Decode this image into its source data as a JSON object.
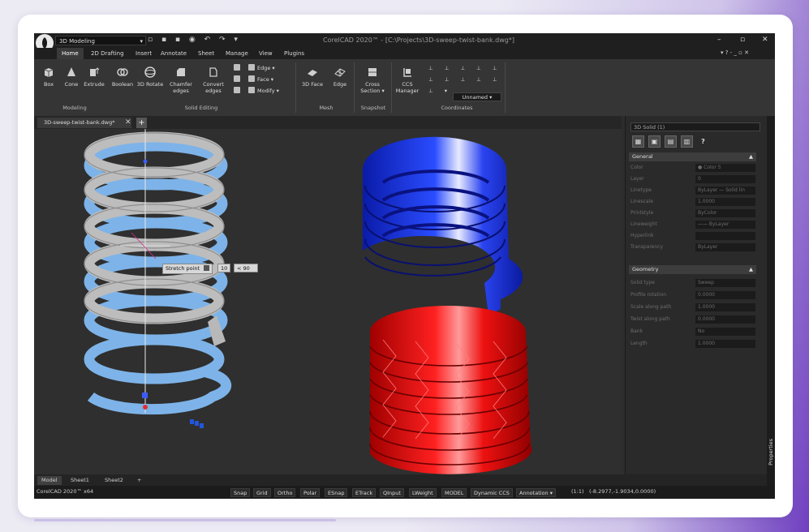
{
  "app": {
    "workspace": "3D Modeling",
    "window_title": "CorelCAD 2020™ - [C:\\Projects\\3D-sweep-twist-bank.dwg*]",
    "brand_color": "#ffffff"
  },
  "menu": {
    "items": [
      "Home",
      "2D Drafting",
      "Insert",
      "Annotate",
      "Sheet",
      "Manage",
      "View",
      "Plugins"
    ],
    "right": "▾  ?  -  _  ▫  ✕"
  },
  "ribbon": {
    "buttons": {
      "box": "Box",
      "cone": "Cone",
      "extrude": "Extrude",
      "boolean": "Boolean",
      "rotate3d": "3D Rotate",
      "chamfer": "Chamfer edges",
      "convert": "Convert edges",
      "edge": "Edge",
      "face": "Face",
      "modify": "Modify",
      "face3d": "3D Face",
      "edge_mesh": "Edge",
      "cross": "Cross Section",
      "ccs": "CCS Manager"
    },
    "groups": {
      "modeling": "Modeling",
      "solid_editing": "Solid Editing",
      "mesh": "Mesh",
      "snapshot": "Snapshot",
      "coordinates": "Coordinates"
    },
    "ccs_value": "Unnamed"
  },
  "document": {
    "tab": "3D-sweep-twist-bank.dwg*"
  },
  "viewport": {
    "stretch_label": "Stretch point",
    "input_value": "10",
    "angle_value": "< 90"
  },
  "properties": {
    "selection": "3D Solid (1)",
    "general_header": "General",
    "geometry_header": "Geometry",
    "general_rows": [
      {
        "label": "Color",
        "value": "● Color 5"
      },
      {
        "label": "Layer",
        "value": "0"
      },
      {
        "label": "Linetype",
        "value": "ByLayer — Solid lin"
      },
      {
        "label": "Linescale",
        "value": "1.0000"
      },
      {
        "label": "Printstyle",
        "value": "ByColor"
      },
      {
        "label": "Lineweight",
        "value": "—— ByLayer"
      },
      {
        "label": "Hyperlink",
        "value": ""
      },
      {
        "label": "Transparency",
        "value": "ByLayer"
      }
    ],
    "geometry_rows": [
      {
        "label": "Solid type",
        "value": "Sweep"
      },
      {
        "label": "Profile rotation",
        "value": "0.0000"
      },
      {
        "label": "Scale along path",
        "value": "1.0000"
      },
      {
        "label": "Twist along path",
        "value": "0.0000"
      },
      {
        "label": "Bank",
        "value": "No"
      },
      {
        "label": "Length",
        "value": "1.0000"
      }
    ],
    "side_label": "Properties"
  },
  "model_tabs": [
    "Model",
    "Sheet1",
    "Sheet2",
    "+"
  ],
  "status": {
    "app_text": "CorelCAD 2020™ x64",
    "buttons": [
      "Snap",
      "Grid",
      "Ortho",
      "Polar",
      "ESnap",
      "ETrack",
      "QInput",
      "LWeight",
      "MODEL",
      "Dynamic CCS",
      "Annotation"
    ],
    "scale": "(1:1)",
    "coords": "(-8.2977,-1.9034,0.0000)"
  },
  "colors": {
    "spring_gray": "#b9b9b9",
    "spring_light_blue": "#7db3e8",
    "solid_blue": "#1530e0",
    "solid_red": "#e81010"
  }
}
